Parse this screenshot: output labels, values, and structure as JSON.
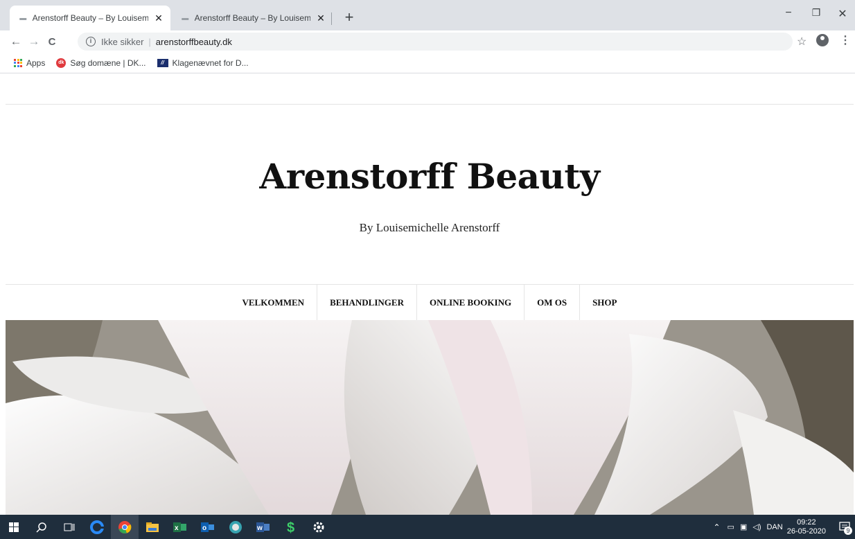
{
  "browser": {
    "tabs": [
      {
        "title": "Arenstorff Beauty – By Louisemic",
        "active": true
      },
      {
        "title": "Arenstorff Beauty – By Louisemic",
        "active": false
      }
    ],
    "close_glyph": "✕",
    "newtab_glyph": "+",
    "window_controls": {
      "minimize": "−",
      "restore": "❐",
      "close": "✕"
    },
    "omnibox": {
      "security_label": "Ikke sikker",
      "url": "arenstorffbeauty.dk"
    },
    "nav": {
      "back": "←",
      "forward": "→",
      "reload": "C",
      "star": "☆",
      "menu": "⋮"
    },
    "bookmarks": [
      {
        "label": "Apps",
        "icon": "apps-grid-icon"
      },
      {
        "label": "Søg domæne | DK...",
        "icon": "dk-hostmaster-icon"
      },
      {
        "label": "Klagenævnet for D...",
        "icon": "klagenaevnet-icon"
      }
    ]
  },
  "site": {
    "title": "Arenstorff Beauty",
    "tagline": "By Louisemichelle Arenstorff",
    "menu": [
      "VELKOMMEN",
      "BEHANDLINGER",
      "ONLINE BOOKING",
      "OM OS",
      "SHOP"
    ],
    "hero_image": "white-magnolia-flower-image"
  },
  "taskbar": {
    "language": "DAN",
    "time": "09:22",
    "date": "26-05-2020",
    "notification_count": "9"
  },
  "colors": {
    "tabstrip": "#dee1e6",
    "taskbar": "#1f2e3d",
    "title": "#111111"
  }
}
